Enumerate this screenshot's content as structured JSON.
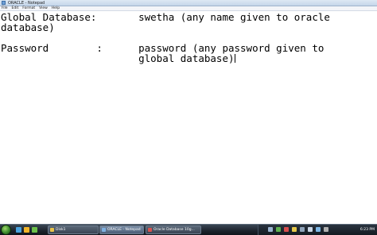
{
  "window": {
    "title": "ORACLE - Notepad"
  },
  "menu": {
    "items": [
      "File",
      "Edit",
      "Format",
      "View",
      "Help"
    ]
  },
  "editor": {
    "lines": [
      "Global Database:       swetha (any name given to oracle",
      "database)",
      "",
      "Password        :      password (any password given to",
      "                       global database)"
    ]
  },
  "taskbar": {
    "buttons": [
      {
        "label": "Disk1",
        "icon_color": "#e8c34a"
      },
      {
        "label": "ORACLE - Notepad",
        "icon_color": "#7fb0e0"
      },
      {
        "label": "Oracle Database 10g...",
        "icon_color": "#d9534f"
      }
    ],
    "clock": "6:23 PM",
    "quick_launch_colors": [
      "#4aa3df",
      "#f0b429",
      "#6cc04a"
    ],
    "tray_icon_colors": [
      "#9ab3d0",
      "#5fb14f",
      "#d64d4d",
      "#e6c84a",
      "#8fa3ba",
      "#c9d6e6",
      "#7db7e6",
      "#b0b0b0"
    ]
  }
}
